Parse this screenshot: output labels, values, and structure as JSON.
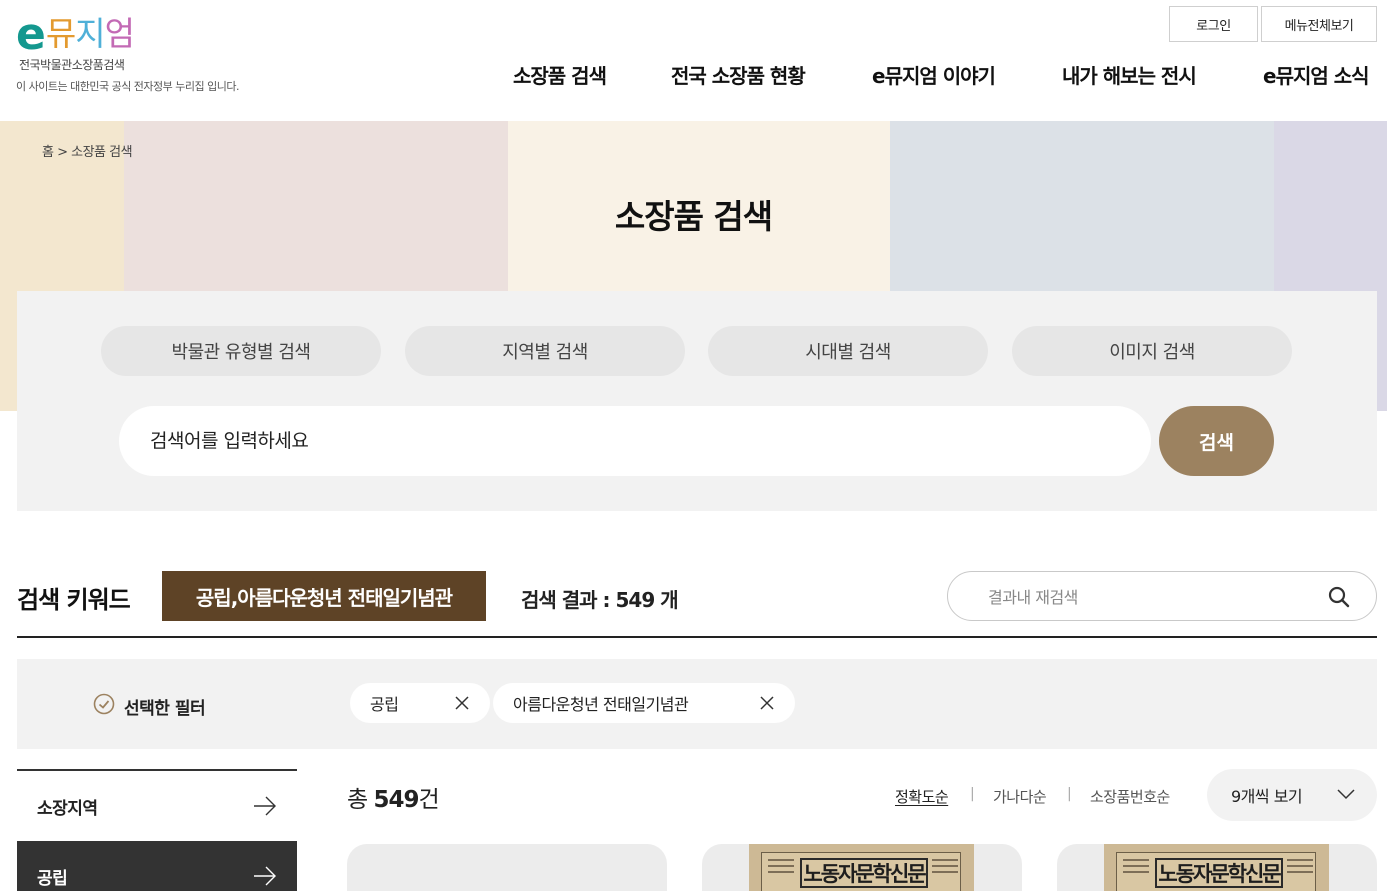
{
  "header": {
    "logo": {
      "e": "e",
      "word_1": "뮤",
      "word_2": "지",
      "word_3": "엄",
      "subtitle": "전국박물관소장품검색"
    },
    "gov_note": "이 사이트는 대한민국 공식 전자정부 누리집 입니다.",
    "login": "로그인",
    "all_menu": "메뉴전체보기",
    "nav": [
      "소장품 검색",
      "전국 소장품 현황",
      "e뮤지엄 이야기",
      "내가 해보는 전시",
      "e뮤지엄 소식"
    ]
  },
  "banner": {
    "breadcrumb": "홈 > 소장품 검색",
    "title": "소장품 검색",
    "band_colors": [
      "#f3e7cf",
      "#ece0dd",
      "#f9f2e6",
      "#dce1e7",
      "#dad8e6"
    ]
  },
  "search": {
    "categories": [
      "박물관 유형별 검색",
      "지역별 검색",
      "시대별 검색",
      "이미지 검색"
    ],
    "input_value": "검색어를 입력하세요",
    "button": "검색"
  },
  "keyword": {
    "label": "검색 키워드",
    "chip": "공립,아름다운청년 전태일기념관",
    "result_text": "검색 결과 : 549 개",
    "re_search_placeholder": "결과내 재검색"
  },
  "filters": {
    "label": "선택한 필터",
    "chips": [
      "공립",
      "아름다운청년 전태일기념관"
    ]
  },
  "sidebar": {
    "items": [
      {
        "label": "소장지역"
      },
      {
        "label": "공립"
      }
    ]
  },
  "results": {
    "total_prefix": "총 ",
    "total_count": "549",
    "total_suffix": "건",
    "sort_options": [
      "정확도순",
      "가나다순",
      "소장품번호순"
    ],
    "per_page": "9개씩 보기",
    "cards": [
      {
        "title": ""
      },
      {
        "title": "노동자문학신문"
      },
      {
        "title": "노동자문학신문"
      }
    ]
  },
  "colors": {
    "accent_brown": "#9c8260",
    "keyword_chip": "#5e4326",
    "sidebar_active": "#333333",
    "panel_gray": "#f2f2f2"
  }
}
